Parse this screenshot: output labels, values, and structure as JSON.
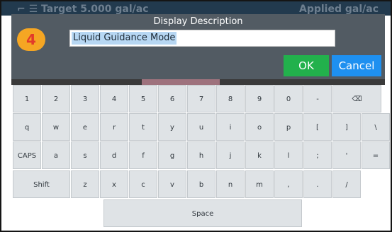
{
  "background": {
    "left_text": "⌐ ☰  Target 5.000 gal/ac",
    "right_text": "Applied   gal/ac"
  },
  "dialog": {
    "title": "Display Description",
    "input_value": "Liquid Guidance Mode",
    "ok_label": "OK",
    "cancel_label": "Cancel"
  },
  "badge": "4",
  "keyboard": {
    "row1": [
      "1",
      "2",
      "3",
      "4",
      "5",
      "6",
      "7",
      "8",
      "9",
      "0",
      "-",
      "⌫"
    ],
    "row2": [
      "q",
      "w",
      "e",
      "r",
      "t",
      "y",
      "u",
      "i",
      "o",
      "p",
      "[",
      "]",
      "\\"
    ],
    "row3": [
      "CAPS",
      "a",
      "s",
      "d",
      "f",
      "g",
      "h",
      "j",
      "k",
      "l",
      ";",
      "'",
      "="
    ],
    "row4": [
      "Shift",
      "z",
      "x",
      "c",
      "v",
      "b",
      "n",
      "m",
      ",",
      ".",
      "/"
    ],
    "space": "Space"
  },
  "colors": {
    "dialog_bg": "#525b63",
    "ok": "#22b14c",
    "cancel": "#1e90f0",
    "key_bg": "#dfe3e6",
    "badge": "#f5a623"
  }
}
